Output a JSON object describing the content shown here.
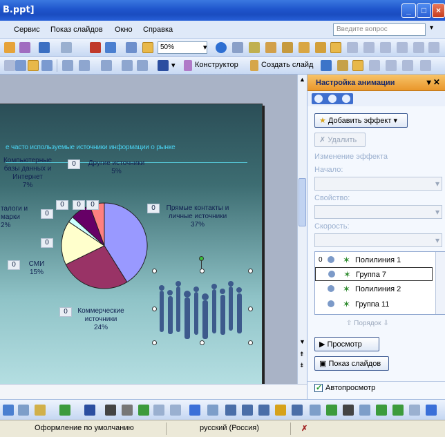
{
  "window": {
    "title": "B.ppt]"
  },
  "menu": {
    "items": [
      "Сервис",
      "Показ слайдов",
      "Окно",
      "Справка"
    ],
    "ask_placeholder": "Введите вопрос"
  },
  "toolbar": {
    "zoom": "50%",
    "designer_label": "Конструктор",
    "new_slide_label": "Создать слайд"
  },
  "slide": {
    "title": "е часто используемые источники информации о рынке",
    "labels": {
      "computer": "Компьютерные базы данных и Интернет 7%",
      "computer_l1": "Компьютерные",
      "computer_l2": "базы данных и",
      "computer_l3": "Интернет",
      "computer_pct": "7%",
      "other_l1": "Другие источники",
      "other_pct": "5%",
      "catalog_l1": "талоги и",
      "catalog_l2": "марки",
      "catalog_pct": "2%",
      "direct_l1": "Прямые контакты и",
      "direct_l2": "личные источники",
      "direct_pct": "37%",
      "smi_l1": "СМИ",
      "smi_pct": "15%",
      "comm_l1": "Коммерческие",
      "comm_l2": "источники",
      "comm_pct": "24%"
    },
    "zero_badge": "0"
  },
  "chart_data": {
    "type": "pie",
    "title": "",
    "categories": [
      "Прямые контакты и личные источники",
      "Коммерческие источники",
      "СМИ",
      "Каталоги и марки",
      "Компьютерные базы данных и Интернет",
      "Другие источники"
    ],
    "values": [
      37,
      24,
      15,
      2,
      7,
      5
    ],
    "colors": [
      "#9999ff",
      "#993366",
      "#ffffcc",
      "#ccffff",
      "#660066",
      "#ff8080"
    ]
  },
  "taskpane": {
    "title": "Настройка анимации",
    "add_effect": "Добавить эффект",
    "delete": "Удалить",
    "change_effect": "Изменение эффекта",
    "start_label": "Начало:",
    "property_label": "Свойство:",
    "speed_label": "Скорость:",
    "anim_items": [
      {
        "num": "0",
        "label": "Полилиния 1"
      },
      {
        "num": "",
        "label": "Группа 7"
      },
      {
        "num": "",
        "label": "Полилиния 2"
      },
      {
        "num": "",
        "label": "Группа 11"
      }
    ],
    "reorder": "Порядок",
    "preview": "Просмотр",
    "slideshow": "Показ слайдов",
    "autopreview": "Автопросмотр"
  },
  "status": {
    "design": "Оформление по умолчанию",
    "language": "русский (Россия)"
  }
}
